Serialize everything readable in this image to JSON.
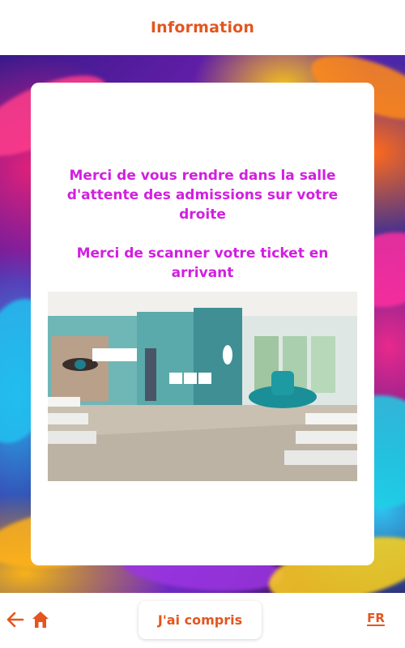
{
  "header": {
    "title": "Information"
  },
  "card": {
    "message_admissions": "Merci de vous rendre dans la salle d'attente des admissions sur votre droite",
    "message_ticket": "Merci de scanner votre ticket en arrivant",
    "photo_icon": "waiting-room-photo"
  },
  "footer": {
    "back_icon": "arrow-left-icon",
    "home_icon": "home-icon",
    "confirm_label": "J'ai compris",
    "language_label": "FR"
  },
  "colors": {
    "accent": "#e4551f",
    "message": "#d21fe0",
    "card": "#ffffff"
  }
}
